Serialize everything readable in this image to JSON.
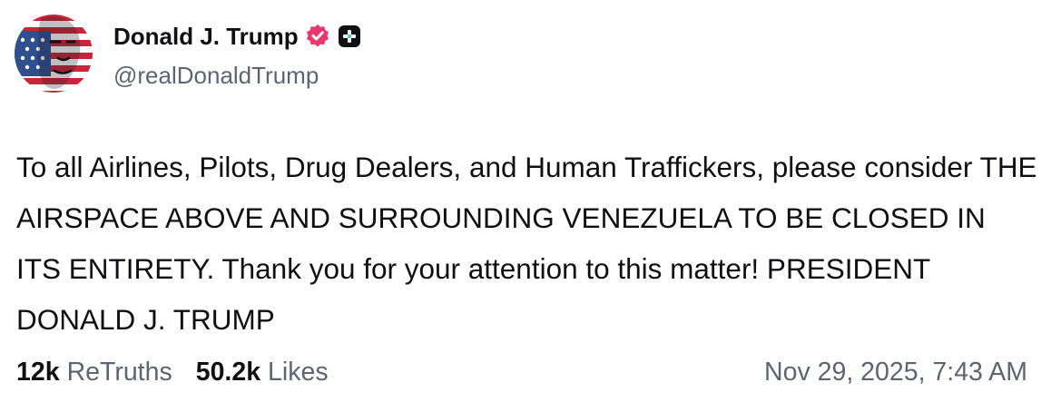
{
  "author": {
    "display_name": "Donald J. Trump",
    "handle": "@realDonaldTrump",
    "verified_badge_icon": "verified-badge-icon",
    "plus_badge_icon": "plus-badge-icon"
  },
  "post": {
    "text": "To all Airlines, Pilots, Drug Dealers, and Human Traffickers, please consider THE AIRSPACE ABOVE AND SURROUNDING VENEZUELA TO BE CLOSED IN ITS ENTIRETY. Thank you for your attention to this matter! PRESIDENT DONALD J. TRUMP",
    "timestamp": "Nov 29, 2025, 7:43 AM"
  },
  "stats": {
    "retruths_count": "12k",
    "retruths_label": "ReTruths",
    "likes_count": "50.2k",
    "likes_label": "Likes"
  },
  "colors": {
    "verified_badge": "#e8386d",
    "secondary_text": "#5e6472",
    "primary_text": "#0f0f14"
  }
}
